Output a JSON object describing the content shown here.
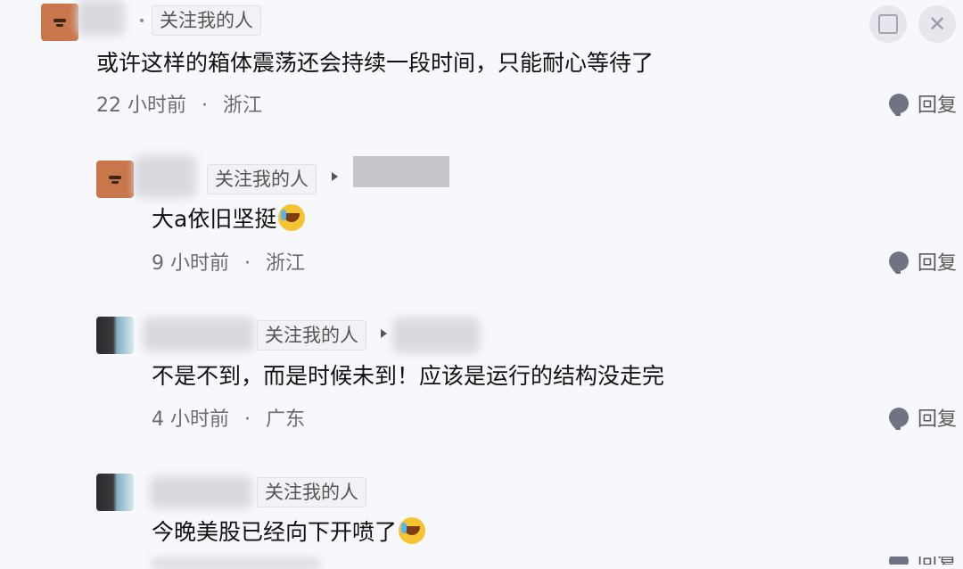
{
  "top_actions": {
    "share_icon": "share-icon",
    "close_icon": "close-icon",
    "close_glyph": "✕"
  },
  "comments": [
    {
      "avatar": "brown-avatar",
      "follow_tag": "关注我的人",
      "text": "或许这样的箱体震荡还会持续一段时间，只能耐心等待了",
      "time": "22 小时前",
      "location": "浙江",
      "reply_label": "回复"
    },
    {
      "avatar": "brown-avatar",
      "follow_tag": "关注我的人",
      "text": "大a依旧坚挺",
      "emoji": "laugh-cry-emoji",
      "time": "9 小时前",
      "location": "浙江",
      "reply_label": "回复"
    },
    {
      "avatar": "photo-avatar",
      "follow_tag": "关注我的人",
      "text": "不是不到，而是时候未到！应该是运行的结构没走完",
      "time": "4 小时前",
      "location": "广东",
      "reply_label": "回复"
    },
    {
      "avatar": "photo-avatar",
      "follow_tag": "关注我的人",
      "text": "今晚美股已经向下开喷了",
      "emoji": "laugh-cry-emoji",
      "reply_label": "回复"
    }
  ],
  "separator": "·"
}
